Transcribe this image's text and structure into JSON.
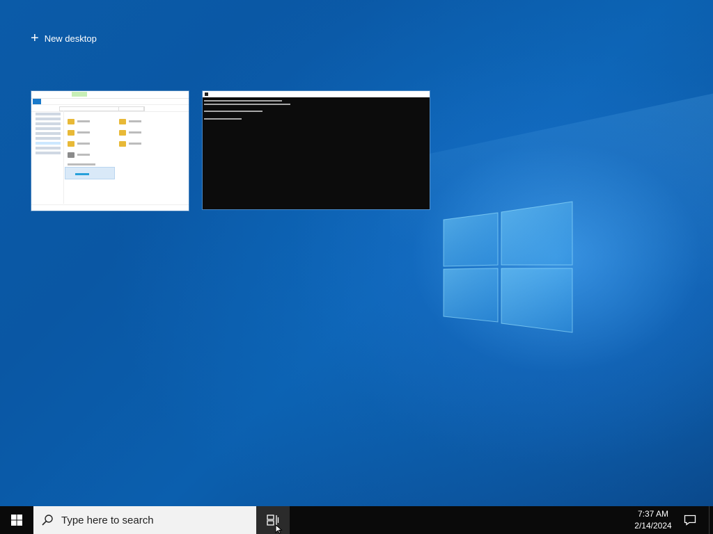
{
  "task_view": {
    "new_desktop_label": "New desktop",
    "new_desktop_icon": "plus-icon"
  },
  "windows": [
    {
      "app": "File Explorer",
      "icon": "folder-icon",
      "selected_ribbon_tab_color": "#c7efb6"
    },
    {
      "app": "Command Prompt",
      "icon": "cmd-icon"
    }
  ],
  "taskbar": {
    "start_icon": "windows-logo-icon",
    "search_placeholder": "Type here to search",
    "search_icon": "search-icon",
    "task_view_icon": "task-view-icon",
    "time": "7:37 AM",
    "date": "2/14/2024",
    "notification_icon": "action-center-icon"
  },
  "colors": {
    "desktop_blue": "#0b5ba8",
    "taskbar": "#0a0a0a",
    "search_box": "#f2f2f2",
    "cmd_background": "#0c0c0c"
  }
}
